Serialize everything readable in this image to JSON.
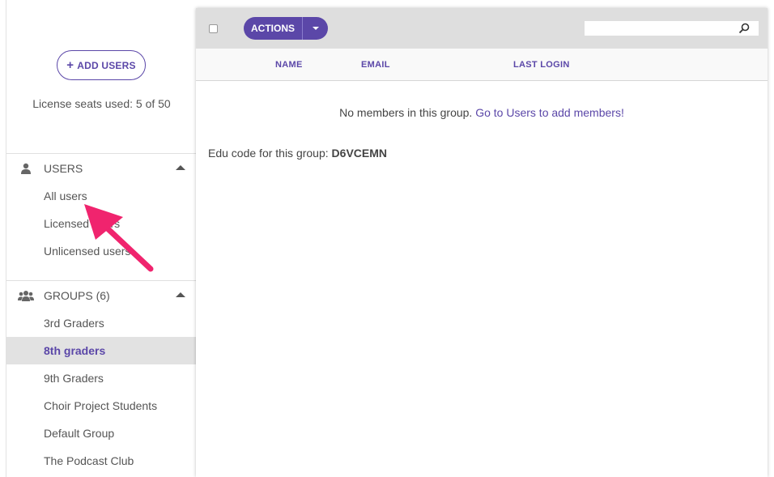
{
  "sidebar": {
    "add_users_label": "ADD USERS",
    "license_text": "License seats used: 5 of 50",
    "users_section": {
      "title": "USERS",
      "items": [
        "All users",
        "Licensed users",
        "Unlicensed users"
      ]
    },
    "groups_section": {
      "title": "GROUPS (6)",
      "items": [
        "3rd Graders",
        "8th graders",
        "9th Graders",
        "Choir Project Students",
        "Default Group",
        "The Podcast Club"
      ],
      "active_item": "8th graders"
    }
  },
  "toolbar": {
    "actions_label": "ACTIONS",
    "search_placeholder": ""
  },
  "table": {
    "columns": [
      "NAME",
      "EMAIL",
      "LAST LOGIN"
    ]
  },
  "main": {
    "empty_text": "No members in this group.",
    "empty_link": "Go to Users to add members!",
    "edu_label": "Edu code for this group:",
    "edu_code": "D6VCEMN"
  },
  "colors": {
    "accent": "#5b47a8",
    "arrow": "#f0246e",
    "active_bg": "#e2e2e2"
  },
  "icons": [
    "plus-icon",
    "user-icon",
    "users-group-icon",
    "caret-up-icon",
    "chevron-down-icon",
    "search-icon",
    "pointer-arrow"
  ]
}
